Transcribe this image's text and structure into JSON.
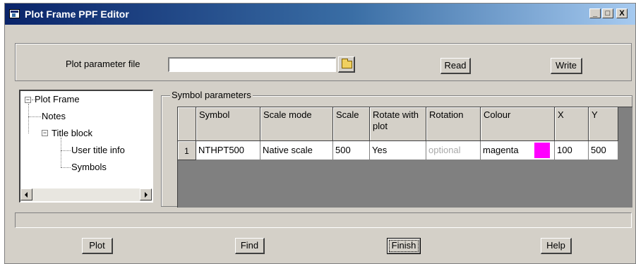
{
  "window": {
    "title": "Plot Frame PPF Editor",
    "controls": {
      "minimize": "_",
      "maximize": "□",
      "close": "X"
    }
  },
  "params": {
    "label": "Plot parameter file",
    "file_value": "",
    "read_label": "Read",
    "write_label": "Write",
    "folder_icon": "folder-open-icon"
  },
  "tree": {
    "items": [
      {
        "label": "Plot Frame",
        "expander": "−"
      },
      {
        "label": "Notes"
      },
      {
        "label": "Title block",
        "expander": "−"
      },
      {
        "label": "User title info"
      },
      {
        "label": "Symbols"
      }
    ]
  },
  "symbols": {
    "group_label": "Symbol parameters",
    "columns": [
      "Symbol",
      "Scale mode",
      "Scale",
      "Rotate with plot",
      "Rotation",
      "Colour",
      "X",
      "Y"
    ],
    "rows": [
      {
        "index": "1",
        "symbol": "NTHPT500",
        "scale_mode": "Native scale",
        "scale": "500",
        "rotate_with_plot": "Yes",
        "rotation_placeholder": "optional",
        "colour": "magenta",
        "colour_swatch": "#ff00ff",
        "x": "100",
        "y": "500"
      }
    ]
  },
  "status": {
    "text": ""
  },
  "buttons": {
    "plot": "Plot",
    "find": "Find",
    "finish": "Finish",
    "help": "Help"
  }
}
